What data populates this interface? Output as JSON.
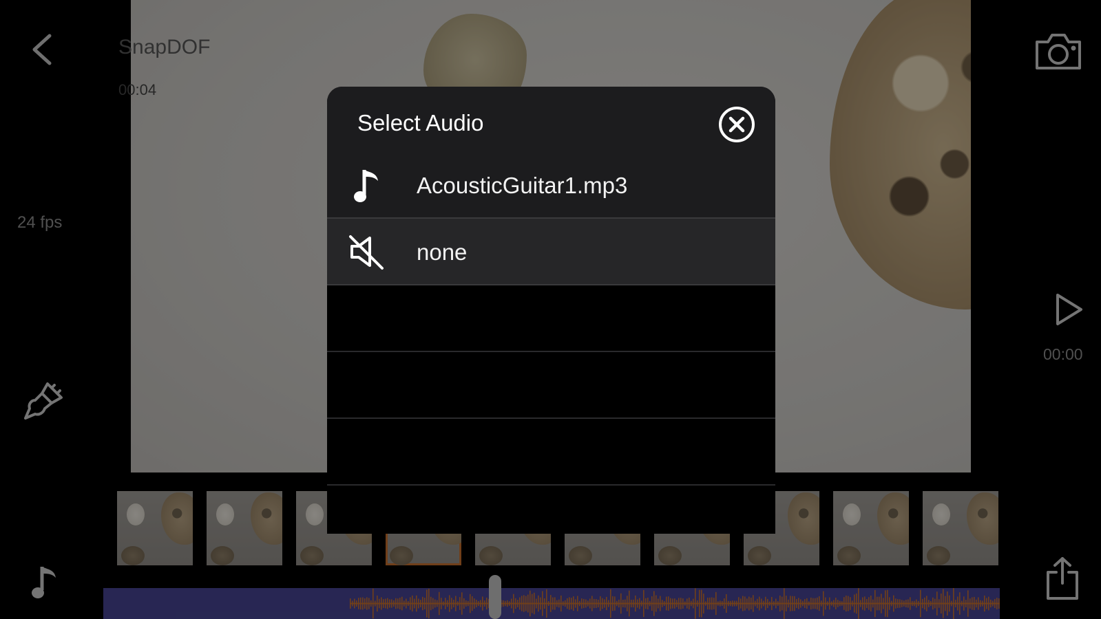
{
  "app": {
    "project_title": "SnapDOF",
    "duration": "00:04",
    "fps": "24 fps",
    "time": "00:00"
  },
  "icons": {
    "back": "chevron-left-icon",
    "camera": "camera-icon",
    "play": "play-icon",
    "brush": "brush-icon",
    "music": "music-note-icon",
    "share": "share-icon",
    "close": "close-circle-icon",
    "mute": "speaker-muted-icon"
  },
  "modal": {
    "title": "Select Audio",
    "options": [
      {
        "label": "AcousticGuitar1.mp3",
        "icon": "music-note-icon"
      },
      {
        "label": "none",
        "icon": "speaker-muted-icon",
        "highlighted": true
      }
    ]
  },
  "timeline": {
    "selected_thumbnail_index": 3,
    "track_color": "#45438f",
    "waveform_color": "#c26d2e"
  }
}
